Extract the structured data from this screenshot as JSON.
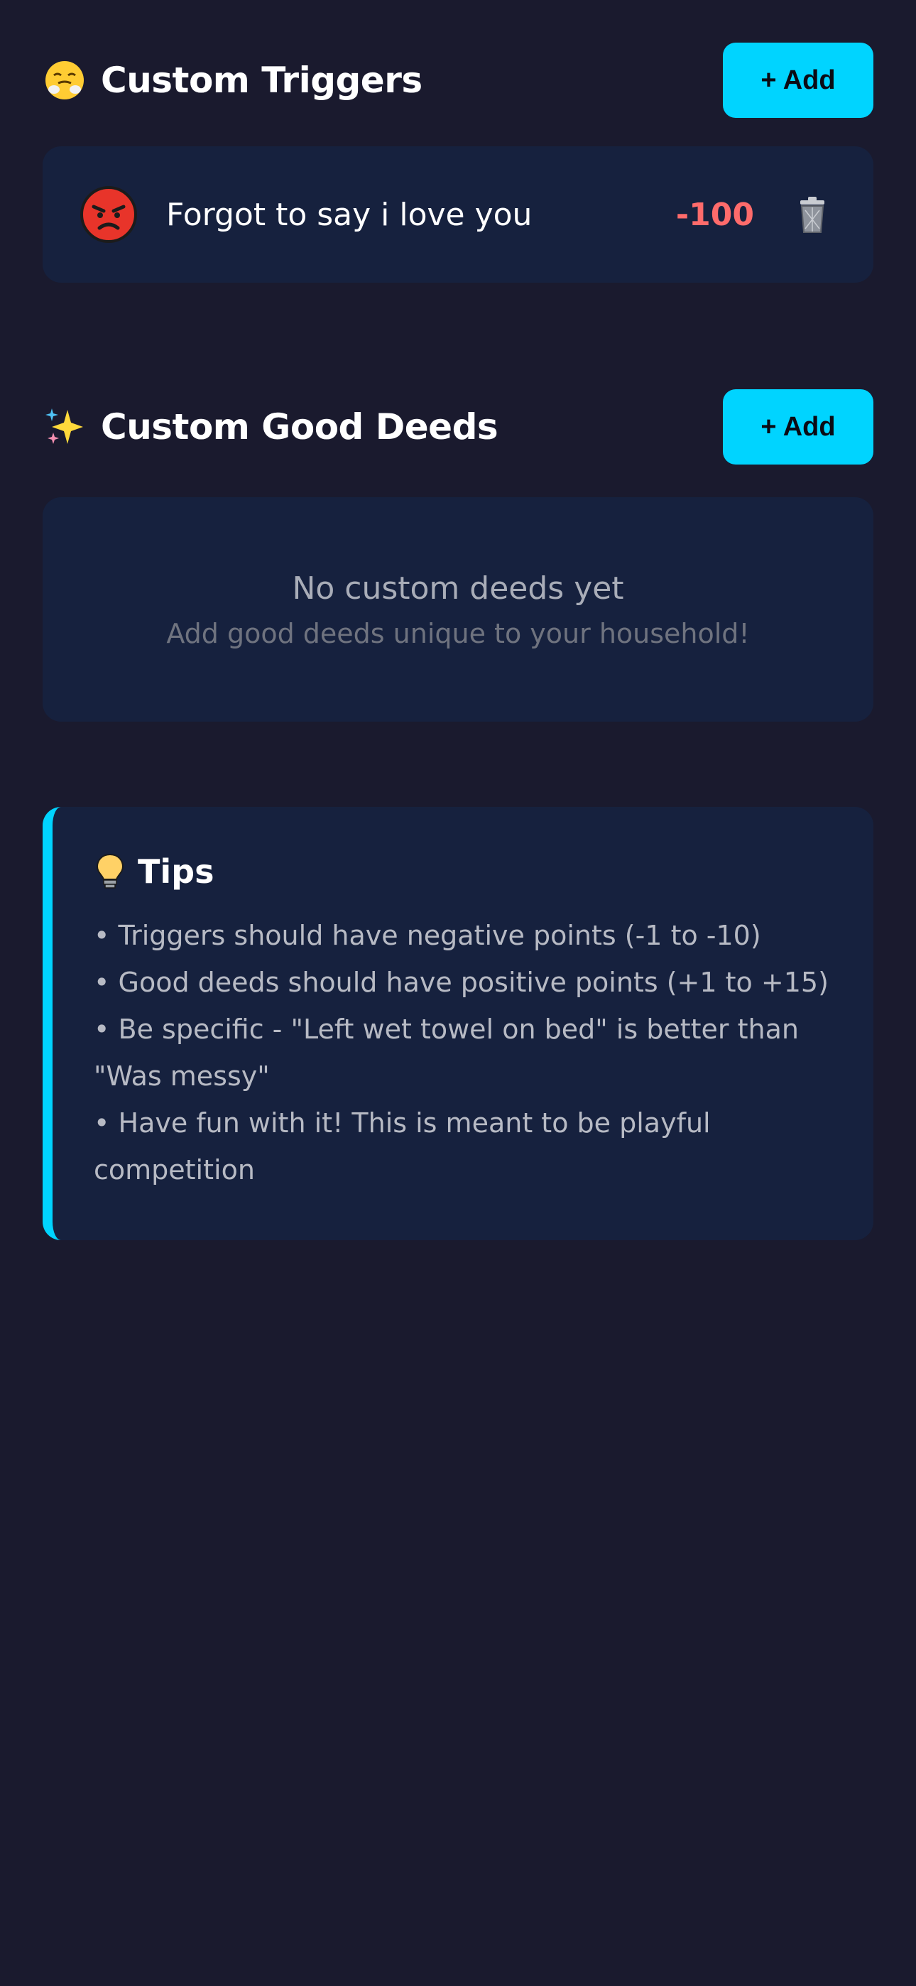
{
  "triggers": {
    "title": "Custom Triggers",
    "icon": "steaming-face-icon",
    "add_label": "+ Add",
    "items": [
      {
        "label": "Forgot to say i love you",
        "points": "-100",
        "icon": "angry-face-icon"
      }
    ]
  },
  "deeds": {
    "title": "Custom Good Deeds",
    "icon": "sparkles-icon",
    "add_label": "+ Add",
    "empty_title": "No custom deeds yet",
    "empty_subtitle": "Add good deeds unique to your household!"
  },
  "tips": {
    "title": "Tips",
    "icon": "lightbulb-icon",
    "lines": [
      "• Triggers should have negative points (-1 to -10)",
      "• Good deeds should have positive points (+1 to +15)",
      "• Be specific - \"Left wet towel on bed\" is better than \"Was messy\"",
      "• Have fun with it! This is meant to be playful competition"
    ]
  },
  "colors": {
    "background": "#1a1a2e",
    "card": "#16213e",
    "accent": "#00d4ff",
    "negative": "#ff6b6b"
  }
}
